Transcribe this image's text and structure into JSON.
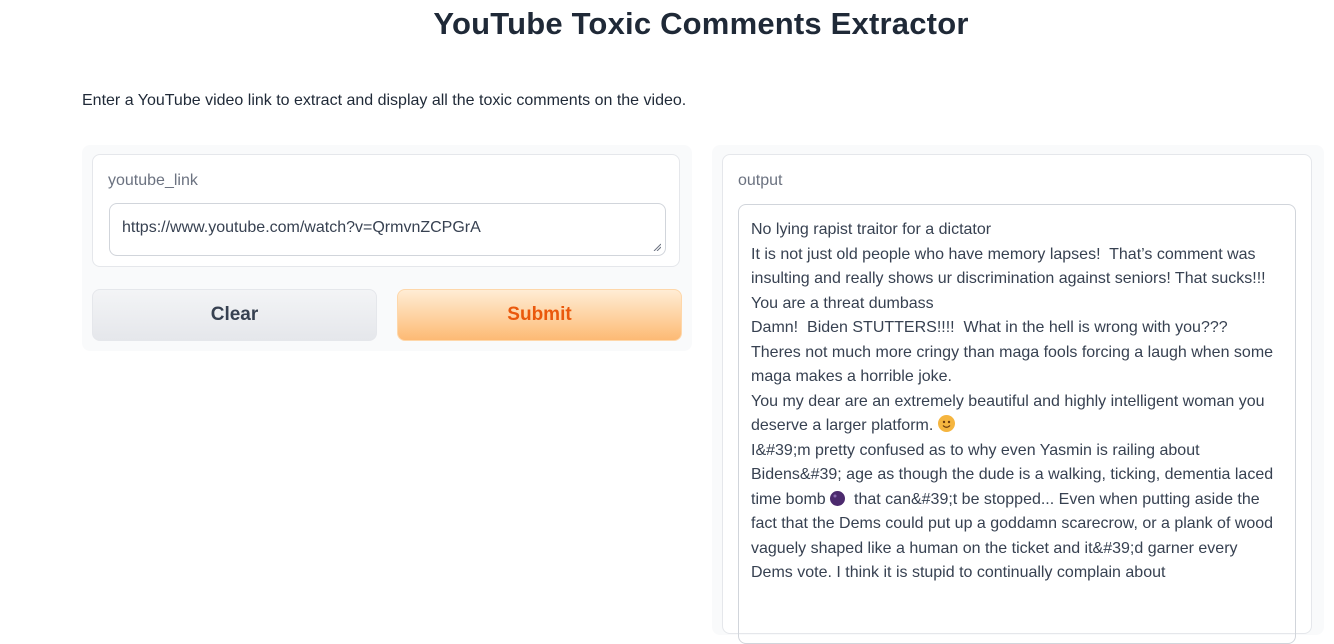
{
  "app": {
    "title": "YouTube Toxic Comments Extractor",
    "description": "Enter a YouTube video link to extract and display all the toxic comments on the video."
  },
  "input": {
    "label": "youtube_link",
    "value": "https://www.youtube.com/watch?v=QrmvnZCPGrA"
  },
  "buttons": {
    "clear_label": "Clear",
    "submit_label": "Submit"
  },
  "output": {
    "label": "output",
    "lines": [
      "No lying rapist traitor for a dictator",
      "It is not just old people who have memory lapses!  That’s comment was insulting and really shows ur discrimination against seniors! That sucks!!!",
      "You are a threat dumbass",
      "Damn!  Biden STUTTERS!!!!  What in the hell is wrong with you???",
      "Theres not much more cringy than maga fools forcing a laugh when some maga makes a horrible joke.",
      "You my dear are an extremely beautiful and highly intelligent woman you deserve a larger platform.",
      "I&#39;m pretty confused as to why even Yasmin is railing about Bidens&#39; age as though the dude is a walking, ticking, dementia laced time bomb",
      "that can&#39;t be stopped... Even when putting aside the fact that the Dems could put up a goddamn scarecrow, or a plank of wood vaguely shaped like a human on the ticket and it&#39;d garner every Dems vote. I think it is stupid to continually complain about"
    ]
  },
  "colors": {
    "submit_text": "#ea580c",
    "submit_bg_start": "#ffedd5",
    "submit_bg_end": "#fdba74"
  },
  "icons": [
    "resize-handle-icon",
    "smiling-face-emoji-icon",
    "bomb-emoji-icon"
  ]
}
